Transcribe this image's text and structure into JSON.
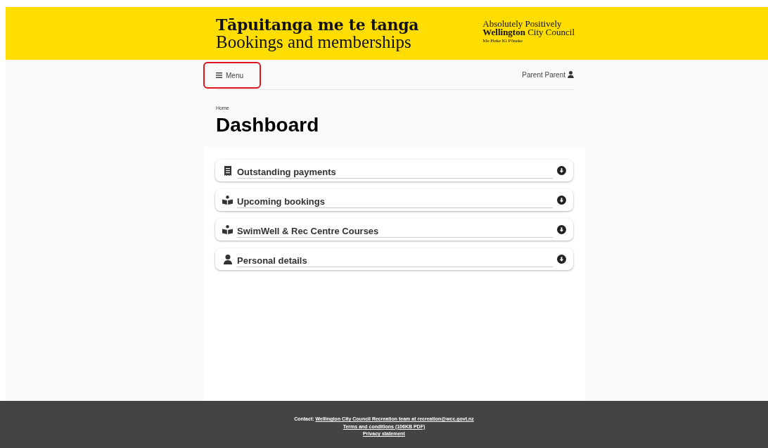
{
  "header": {
    "title": "Tāpuitanga me te tanga",
    "subtitle": "Bookings and memberships",
    "logo_line_1": "Absolutely Positively",
    "logo_line_2_bold": "Wellington",
    "logo_line_2": "City Council",
    "logo_line_3": "Me Heke Ki Pōneke"
  },
  "nav": {
    "menu": {
      "label": "Menu",
      "highlighted": true
    },
    "user": "Parent Parent"
  },
  "breadcrumb": [
    "Home"
  ],
  "page_title": "Dashboard",
  "sections": [
    {
      "label": "Outstanding payments",
      "kind": "receipt",
      "expanded": false
    },
    {
      "label": "Upcoming bookings",
      "kind": "reader",
      "expanded": false
    },
    {
      "label": "SwimWell & Rec Centre Courses",
      "kind": "reader",
      "expanded": false
    },
    {
      "label": "Personal details",
      "kind": "user",
      "expanded": false
    }
  ],
  "footer": {
    "contact_label": "Contact:",
    "contact_link": "Wellington City Council Recreation team at recreation@wcc.govt.nz",
    "terms": "Terms and conditions (106KB PDF)",
    "privacy": "Privacy statement"
  }
}
